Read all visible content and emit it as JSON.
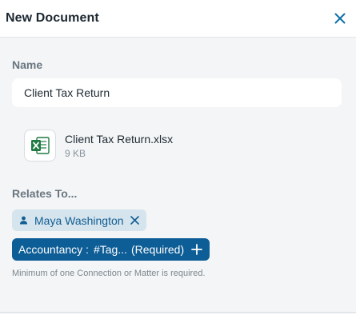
{
  "header": {
    "title": "New Document"
  },
  "form": {
    "name_label": "Name",
    "name_value": "Client Tax Return",
    "file": {
      "name": "Client Tax Return.xlsx",
      "size": "9 KB",
      "icon": "excel-file-icon"
    },
    "relates_label": "Relates To...",
    "person_chip": "Maya Washington",
    "tag_chip": {
      "group": "Accountancy :",
      "tag": "#Tag...",
      "required": "(Required)"
    },
    "hint": "Minimum of one Connection or Matter is required."
  },
  "colors": {
    "accent": "#0d5d96",
    "chip_light": "#d6e4ed",
    "excel_green": "#1f7a44"
  }
}
